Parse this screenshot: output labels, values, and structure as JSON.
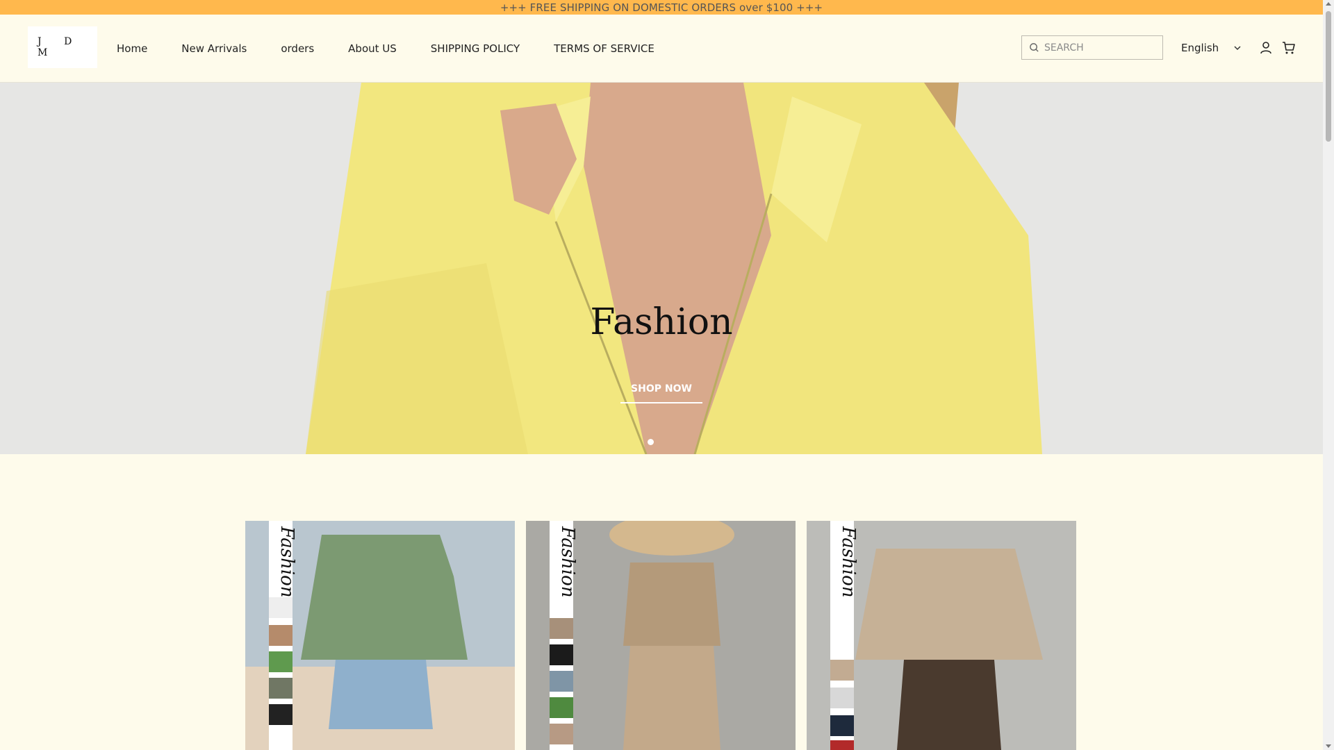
{
  "announcement": {
    "text": "+++ FREE SHIPPING ON DOMESTIC ORDERS over $100 +++"
  },
  "header": {
    "logo_text": "J D M",
    "nav": [
      {
        "label": "Home"
      },
      {
        "label": "New Arrivals"
      },
      {
        "label": "orders"
      },
      {
        "label": "About US"
      },
      {
        "label": "SHIPPING POLICY"
      },
      {
        "label": "TERMS OF SERVICE"
      }
    ],
    "search": {
      "placeholder": "SEARCH",
      "icon": "search-icon"
    },
    "language": {
      "selected": "English",
      "icon": "chevron-down-icon"
    },
    "icons": [
      "account-icon",
      "cart-icon"
    ]
  },
  "hero": {
    "title": "Fashion",
    "cta_label": "SHOP NOW",
    "slides": 1,
    "active_slide": 1
  },
  "products": [
    {
      "label": "Fashion",
      "item": "green knit top with denim shorts"
    },
    {
      "label": "Fashion",
      "item": "beige knit vest and skirt set"
    },
    {
      "label": "Fashion",
      "item": "beige dotted knit sweater"
    }
  ],
  "colors": {
    "announcement_bg": "#ffb84d",
    "page_bg": "#fefbeb",
    "hero_jacket": "#f2e77f",
    "card_stripe": "#ffffff"
  }
}
